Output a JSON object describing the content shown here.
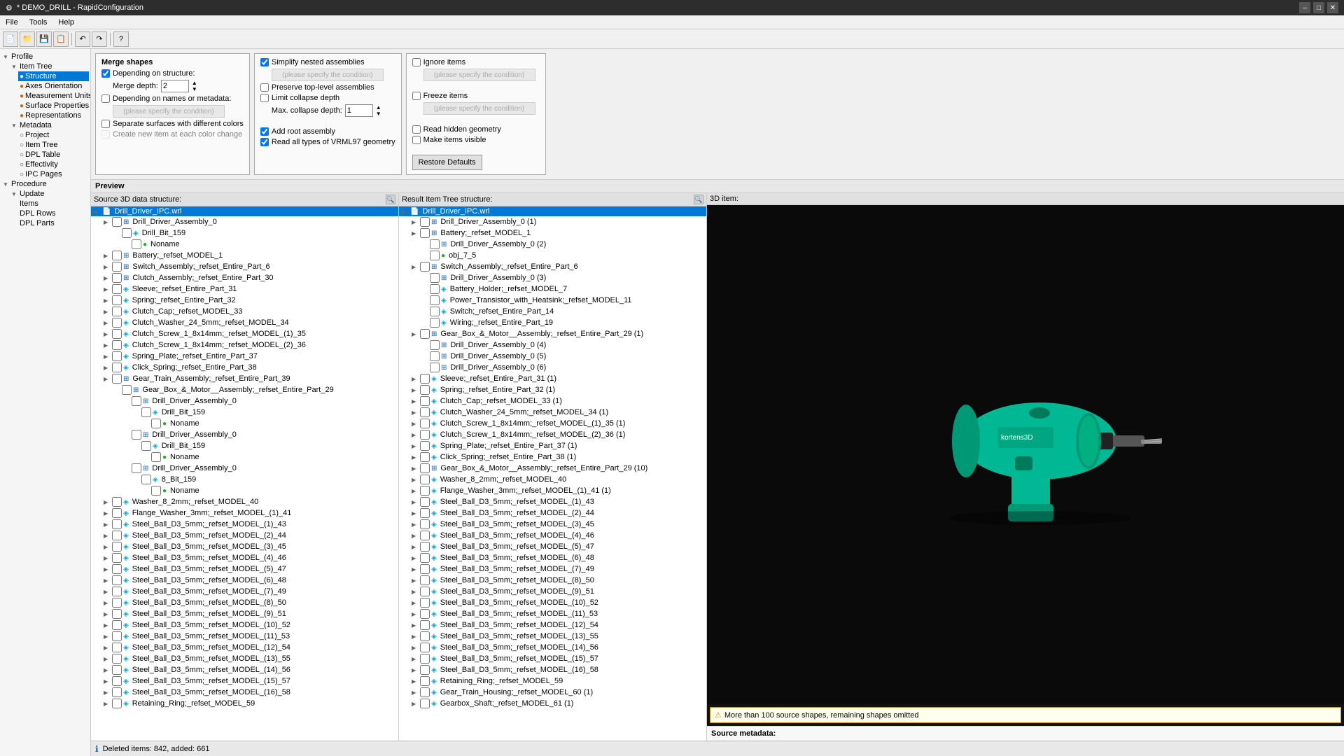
{
  "window": {
    "title": "* DEMO_DRILL - RapidConfiguration"
  },
  "menu": {
    "items": [
      "File",
      "Tools",
      "Help"
    ]
  },
  "toolbar": {
    "buttons": [
      "new",
      "open",
      "save",
      "save-as",
      "undo",
      "redo",
      "help"
    ]
  },
  "sidebar": {
    "profile_label": "Profile",
    "items": [
      {
        "id": "item-tree",
        "label": "Item Tree",
        "level": 1,
        "expandable": true
      },
      {
        "id": "structure",
        "label": "Structure",
        "level": 2,
        "selected": true
      },
      {
        "id": "axes-orientation",
        "label": "Axes Orientation",
        "level": 2
      },
      {
        "id": "measurement-units",
        "label": "Measurement Units",
        "level": 2
      },
      {
        "id": "surface-properties",
        "label": "Surface Properties",
        "level": 2
      },
      {
        "id": "representations",
        "label": "Representations",
        "level": 2
      },
      {
        "id": "metadata",
        "label": "Metadata",
        "level": 1,
        "expandable": true
      },
      {
        "id": "project",
        "label": "Project",
        "level": 2
      },
      {
        "id": "item-tree-2",
        "label": "Item Tree",
        "level": 2
      },
      {
        "id": "dpl-table",
        "label": "DPL Table",
        "level": 2
      },
      {
        "id": "effectivity",
        "label": "Effectivity",
        "level": 2
      },
      {
        "id": "ipc-pages",
        "label": "IPC Pages",
        "level": 2
      },
      {
        "id": "procedure",
        "label": "Procedure",
        "level": 1,
        "expandable": true
      },
      {
        "id": "update",
        "label": "Update",
        "level": 2
      },
      {
        "id": "items",
        "label": "Items",
        "level": 3
      },
      {
        "id": "dpl-rows",
        "label": "DPL Rows",
        "level": 3
      },
      {
        "id": "dpl-parts",
        "label": "DPL Parts",
        "level": 3
      }
    ]
  },
  "config": {
    "merge_shapes_title": "Merge shapes",
    "depending_structure_label": "Depending on structure:",
    "merge_depth_label": "Merge depth:",
    "merge_depth_value": "2",
    "depending_names_label": "Depending on names or metadata:",
    "cond_placeholder": "(please specify the condition)",
    "separate_surfaces_label": "Separate surfaces with different colors",
    "create_new_item_label": "Create new item at each color change",
    "simplify_nested_label": "Simplify nested assemblies",
    "simplify_cond_placeholder": "(please specify the condition)",
    "preserve_toplevel_label": "Preserve top-level assemblies",
    "limit_collapse_label": "Limit collapse depth",
    "max_collapse_label": "Max. collapse depth:",
    "max_collapse_value": "1",
    "add_root_label": "Add root assembly",
    "read_all_types_label": "Read all types of VRML97 geometry",
    "ignore_items_label": "Ignore items",
    "ignore_cond_placeholder": "(please specify the condition)",
    "freeze_items_label": "Freeze items",
    "freeze_cond_placeholder": "(please specify the condition)",
    "read_hidden_label": "Read hidden geometry",
    "make_items_visible_label": "Make items visible",
    "restore_defaults_label": "Restore Defaults"
  },
  "preview": {
    "label": "Preview",
    "source_label": "Source 3D data structure:",
    "result_label": "Result Item Tree structure:",
    "view3d_label": "3D item:",
    "warning_msg": "More than 100 source shapes, remaining shapes omitted",
    "source_metadata_label": "Source metadata:",
    "deleted_added_label": "Deleted items: 842, added: 661"
  },
  "source_tree": {
    "items": [
      {
        "id": "s0",
        "label": "Drill_Driver_IPC.wrl",
        "level": 0,
        "highlighted": true,
        "icon": "file"
      },
      {
        "id": "s1",
        "label": "Drill_Driver_Assembly_0",
        "level": 1,
        "icon": "assembly"
      },
      {
        "id": "s2",
        "label": "Drill_Bit_159",
        "level": 2,
        "icon": "part"
      },
      {
        "id": "s3",
        "label": "Noname",
        "level": 3,
        "icon": "shape"
      },
      {
        "id": "s4",
        "label": "Battery;_refset_MODEL_1",
        "level": 1,
        "icon": "assembly"
      },
      {
        "id": "s5",
        "label": "Switch_Assembly;_refset_Entire_Part_6",
        "level": 1,
        "icon": "assembly"
      },
      {
        "id": "s6",
        "label": "Clutch_Assembly;_refset_Entire_Part_30",
        "level": 1,
        "icon": "assembly"
      },
      {
        "id": "s7",
        "label": "Sleeve;_refset_Entire_Part_31",
        "level": 1,
        "icon": "part"
      },
      {
        "id": "s8",
        "label": "Spring;_refset_Entire_Part_32",
        "level": 1,
        "icon": "part"
      },
      {
        "id": "s9",
        "label": "Clutch_Cap;_refset_MODEL_33",
        "level": 1,
        "icon": "part"
      },
      {
        "id": "s10",
        "label": "Clutch_Washer_24_5mm;_refset_MODEL_34",
        "level": 1,
        "icon": "part"
      },
      {
        "id": "s11",
        "label": "Clutch_Screw_1_8x14mm;_refset_MODEL_(1)_35",
        "level": 1,
        "icon": "part"
      },
      {
        "id": "s12",
        "label": "Clutch_Screw_1_8x14mm;_refset_MODEL_(2)_36",
        "level": 1,
        "icon": "part"
      },
      {
        "id": "s13",
        "label": "Spring_Plate;_refset_Entire_Part_37",
        "level": 1,
        "icon": "part"
      },
      {
        "id": "s14",
        "label": "Click_Spring;_refset_Entire_Part_38",
        "level": 1,
        "icon": "part"
      },
      {
        "id": "s15",
        "label": "Gear_Train_Assembly;_refset_Entire_Part_39",
        "level": 1,
        "icon": "assembly"
      },
      {
        "id": "s16",
        "label": "Gear_Box_&_Motor__Assembly;_refset_Entire_Part_29",
        "level": 2,
        "icon": "assembly"
      },
      {
        "id": "s17",
        "label": "Drill_Driver_Assembly_0",
        "level": 3,
        "icon": "assembly"
      },
      {
        "id": "s18",
        "label": "Drill_Bit_159",
        "level": 4,
        "icon": "part"
      },
      {
        "id": "s19",
        "label": "Noname",
        "level": 5,
        "icon": "shape"
      },
      {
        "id": "s20",
        "label": "Drill_Driver_Assembly_0",
        "level": 3,
        "icon": "assembly"
      },
      {
        "id": "s21",
        "label": "Drill_Bit_159",
        "level": 4,
        "icon": "part"
      },
      {
        "id": "s22",
        "label": "Noname",
        "level": 5,
        "icon": "shape"
      },
      {
        "id": "s23",
        "label": "Drill_Driver_Assembly_0",
        "level": 3,
        "icon": "assembly"
      },
      {
        "id": "s24",
        "label": "8_Bit_159",
        "level": 4,
        "icon": "part"
      },
      {
        "id": "s25",
        "label": "Noname",
        "level": 5,
        "icon": "shape"
      },
      {
        "id": "s26",
        "label": "Washer_8_2mm;_refset_MODEL_40",
        "level": 1,
        "icon": "part"
      },
      {
        "id": "s27",
        "label": "Flange_Washer_3mm;_refset_MODEL_(1)_41",
        "level": 1,
        "icon": "part"
      },
      {
        "id": "s28",
        "label": "Steel_Ball_D3_5mm;_refset_MODEL_(1)_43",
        "level": 1,
        "icon": "part"
      },
      {
        "id": "s29",
        "label": "Steel_Ball_D3_5mm;_refset_MODEL_(2)_44",
        "level": 1,
        "icon": "part"
      },
      {
        "id": "s30",
        "label": "Steel_Ball_D3_5mm;_refset_MODEL_(3)_45",
        "level": 1,
        "icon": "part"
      },
      {
        "id": "s31",
        "label": "Steel_Ball_D3_5mm;_refset_MODEL_(4)_46",
        "level": 1,
        "icon": "part"
      },
      {
        "id": "s32",
        "label": "Steel_Ball_D3_5mm;_refset_MODEL_(5)_47",
        "level": 1,
        "icon": "part"
      },
      {
        "id": "s33",
        "label": "Steel_Ball_D3_5mm;_refset_MODEL_(6)_48",
        "level": 1,
        "icon": "part"
      },
      {
        "id": "s34",
        "label": "Steel_Ball_D3_5mm;_refset_MODEL_(7)_49",
        "level": 1,
        "icon": "part"
      },
      {
        "id": "s35",
        "label": "Steel_Ball_D3_5mm;_refset_MODEL_(8)_50",
        "level": 1,
        "icon": "part"
      },
      {
        "id": "s36",
        "label": "Steel_Ball_D3_5mm;_refset_MODEL_(9)_51",
        "level": 1,
        "icon": "part"
      },
      {
        "id": "s37",
        "label": "Steel_Ball_D3_5mm;_refset_MODEL_(10)_52",
        "level": 1,
        "icon": "part"
      },
      {
        "id": "s38",
        "label": "Steel_Ball_D3_5mm;_refset_MODEL_(11)_53",
        "level": 1,
        "icon": "part"
      },
      {
        "id": "s39",
        "label": "Steel_Ball_D3_5mm;_refset_MODEL_(12)_54",
        "level": 1,
        "icon": "part"
      },
      {
        "id": "s40",
        "label": "Steel_Ball_D3_5mm;_refset_MODEL_(13)_55",
        "level": 1,
        "icon": "part"
      },
      {
        "id": "s41",
        "label": "Steel_Ball_D3_5mm;_refset_MODEL_(14)_56",
        "level": 1,
        "icon": "part"
      },
      {
        "id": "s42",
        "label": "Steel_Ball_D3_5mm;_refset_MODEL_(15)_57",
        "level": 1,
        "icon": "part"
      },
      {
        "id": "s43",
        "label": "Steel_Ball_D3_5mm;_refset_MODEL_(16)_58",
        "level": 1,
        "icon": "part"
      },
      {
        "id": "s44",
        "label": "Retaining_Ring;_refset_MODEL_59",
        "level": 1,
        "icon": "part"
      }
    ]
  },
  "result_tree": {
    "items": [
      {
        "id": "r0",
        "label": "Drill_Driver_IPC.wrl",
        "level": 0,
        "highlighted": true,
        "icon": "file"
      },
      {
        "id": "r1",
        "label": "Drill_Driver_Assembly_0 (1)",
        "level": 1,
        "icon": "assembly"
      },
      {
        "id": "r2",
        "label": "Battery;_refset_MODEL_1",
        "level": 1,
        "icon": "assembly"
      },
      {
        "id": "r3",
        "label": "Drill_Driver_Assembly_0 (2)",
        "level": 2,
        "icon": "assembly"
      },
      {
        "id": "r4",
        "label": "obj_7_5",
        "level": 2,
        "icon": "shape"
      },
      {
        "id": "r5",
        "label": "Switch_Assembly;_refset_Entire_Part_6",
        "level": 1,
        "icon": "assembly"
      },
      {
        "id": "r6",
        "label": "Drill_Driver_Assembly_0 (3)",
        "level": 2,
        "icon": "assembly"
      },
      {
        "id": "r7",
        "label": "Battery_Holder;_refset_MODEL_7",
        "level": 2,
        "icon": "part"
      },
      {
        "id": "r8",
        "label": "Power_Transistor_with_Heatsink;_refset_MODEL_11",
        "level": 2,
        "icon": "part"
      },
      {
        "id": "r9",
        "label": "Switch;_refset_Entire_Part_14",
        "level": 2,
        "icon": "part"
      },
      {
        "id": "r10",
        "label": "Wiring;_refset_Entire_Part_19",
        "level": 2,
        "icon": "part"
      },
      {
        "id": "r11",
        "label": "Gear_Box_&_Motor__Assembly;_refset_Entire_Part_29 (1)",
        "level": 1,
        "icon": "assembly"
      },
      {
        "id": "r12",
        "label": "Drill_Driver_Assembly_0 (4)",
        "level": 2,
        "icon": "assembly"
      },
      {
        "id": "r13",
        "label": "Drill_Driver_Assembly_0 (5)",
        "level": 2,
        "icon": "assembly"
      },
      {
        "id": "r14",
        "label": "Drill_Driver_Assembly_0 (6)",
        "level": 2,
        "icon": "assembly"
      },
      {
        "id": "r15",
        "label": "Sleeve;_refset_Entire_Part_31 (1)",
        "level": 1,
        "icon": "part"
      },
      {
        "id": "r16",
        "label": "Spring;_refset_Entire_Part_32 (1)",
        "level": 1,
        "icon": "part"
      },
      {
        "id": "r17",
        "label": "Clutch_Cap;_refset_MODEL_33 (1)",
        "level": 1,
        "icon": "part"
      },
      {
        "id": "r18",
        "label": "Clutch_Washer_24_5mm;_refset_MODEL_34 (1)",
        "level": 1,
        "icon": "part"
      },
      {
        "id": "r19",
        "label": "Clutch_Screw_1_8x14mm;_refset_MODEL_(1)_35 (1)",
        "level": 1,
        "icon": "part"
      },
      {
        "id": "r20",
        "label": "Clutch_Screw_1_8x14mm;_refset_MODEL_(2)_36 (1)",
        "level": 1,
        "icon": "part"
      },
      {
        "id": "r21",
        "label": "Spring_Plate;_refset_Entire_Part_37 (1)",
        "level": 1,
        "icon": "part"
      },
      {
        "id": "r22",
        "label": "Click_Spring;_refset_Entire_Part_38 (1)",
        "level": 1,
        "icon": "part"
      },
      {
        "id": "r23",
        "label": "Gear_Box_&_Motor__Assembly;_refset_Entire_Part_29 (10)",
        "level": 1,
        "icon": "assembly"
      },
      {
        "id": "r24",
        "label": "Washer_8_2mm;_refset_MODEL_40",
        "level": 1,
        "icon": "part"
      },
      {
        "id": "r25",
        "label": "Flange_Washer_3mm;_refset_MODEL_(1)_41 (1)",
        "level": 1,
        "icon": "part"
      },
      {
        "id": "r26",
        "label": "Steel_Ball_D3_5mm;_refset_MODEL_(1)_43",
        "level": 1,
        "icon": "part"
      },
      {
        "id": "r27",
        "label": "Steel_Ball_D3_5mm;_refset_MODEL_(2)_44",
        "level": 1,
        "icon": "part"
      },
      {
        "id": "r28",
        "label": "Steel_Ball_D3_5mm;_refset_MODEL_(3)_45",
        "level": 1,
        "icon": "part"
      },
      {
        "id": "r29",
        "label": "Steel_Ball_D3_5mm;_refset_MODEL_(4)_46",
        "level": 1,
        "icon": "part"
      },
      {
        "id": "r30",
        "label": "Steel_Ball_D3_5mm;_refset_MODEL_(5)_47",
        "level": 1,
        "icon": "part"
      },
      {
        "id": "r31",
        "label": "Steel_Ball_D3_5mm;_refset_MODEL_(6)_48",
        "level": 1,
        "icon": "part"
      },
      {
        "id": "r32",
        "label": "Steel_Ball_D3_5mm;_refset_MODEL_(7)_49",
        "level": 1,
        "icon": "part"
      },
      {
        "id": "r33",
        "label": "Steel_Ball_D3_5mm;_refset_MODEL_(8)_50",
        "level": 1,
        "icon": "part"
      },
      {
        "id": "r34",
        "label": "Steel_Ball_D3_5mm;_refset_MODEL_(9)_51",
        "level": 1,
        "icon": "part"
      },
      {
        "id": "r35",
        "label": "Steel_Ball_D3_5mm;_refset_MODEL_(10)_52",
        "level": 1,
        "icon": "part"
      },
      {
        "id": "r36",
        "label": "Steel_Ball_D3_5mm;_refset_MODEL_(11)_53",
        "level": 1,
        "icon": "part"
      },
      {
        "id": "r37",
        "label": "Steel_Ball_D3_5mm;_refset_MODEL_(12)_54",
        "level": 1,
        "icon": "part"
      },
      {
        "id": "r38",
        "label": "Steel_Ball_D3_5mm;_refset_MODEL_(13)_55",
        "level": 1,
        "icon": "part"
      },
      {
        "id": "r39",
        "label": "Steel_Ball_D3_5mm;_refset_MODEL_(14)_56",
        "level": 1,
        "icon": "part"
      },
      {
        "id": "r40",
        "label": "Steel_Ball_D3_5mm;_refset_MODEL_(15)_57",
        "level": 1,
        "icon": "part"
      },
      {
        "id": "r41",
        "label": "Steel_Ball_D3_5mm;_refset_MODEL_(16)_58",
        "level": 1,
        "icon": "part"
      },
      {
        "id": "r42",
        "label": "Retaining_Ring;_refset_MODEL_59",
        "level": 1,
        "icon": "part"
      },
      {
        "id": "r43",
        "label": "Gear_Train_Housing;_refset_MODEL_60 (1)",
        "level": 1,
        "icon": "part"
      },
      {
        "id": "r44",
        "label": "Gearbox_Shaft;_refset_MODEL_61 (1)",
        "level": 1,
        "icon": "part"
      }
    ]
  }
}
